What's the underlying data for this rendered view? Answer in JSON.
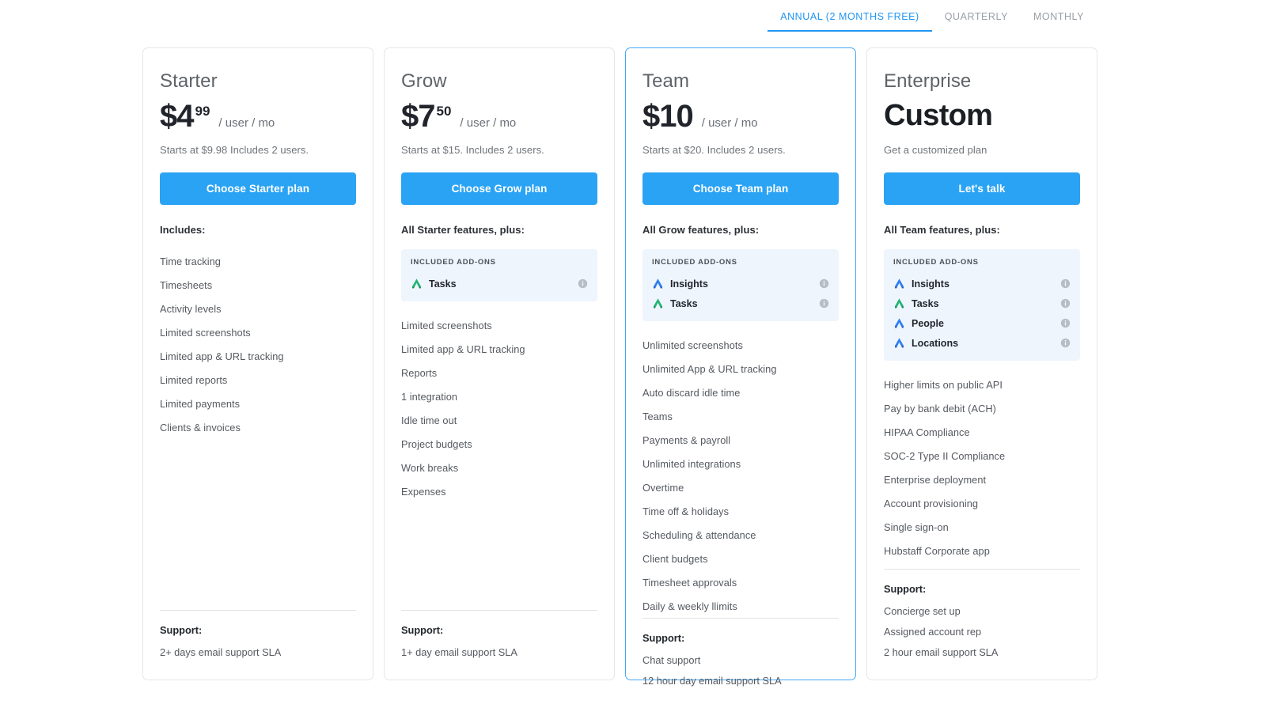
{
  "billing_tabs": [
    {
      "label": "ANNUAL (2 MONTHS FREE)",
      "active": true
    },
    {
      "label": "QUARTERLY",
      "active": false
    },
    {
      "label": "MONTHLY",
      "active": false
    }
  ],
  "colors": {
    "accent": "#2aa3f5",
    "tab_active": "#2196f3",
    "featured_border": "#43a9f5",
    "addon_box_bg": "#eef5fd",
    "icon_green": "#22b573",
    "icon_blue": "#2f7ff0"
  },
  "plans": [
    {
      "name": "Starter",
      "price_amount": "$4",
      "price_cents": "99",
      "price_unit": "/ user / mo",
      "price_note": "Starts at $9.98 Includes 2 users.",
      "cta_label": "Choose Starter plan",
      "includes_label": "Includes:",
      "featured": false,
      "addons": [],
      "features": [
        "Time tracking",
        "Timesheets",
        "Activity levels",
        "Limited screenshots",
        "Limited app & URL tracking",
        "Limited reports",
        "Limited payments",
        "Clients & invoices"
      ],
      "support_title": "Support:",
      "support_items": [
        "2+ days email support SLA"
      ]
    },
    {
      "name": "Grow",
      "price_amount": "$7",
      "price_cents": "50",
      "price_unit": "/ user / mo",
      "price_note": "Starts at $15. Includes 2 users.",
      "cta_label": "Choose Grow plan",
      "includes_label": "All Starter features, plus:",
      "featured": false,
      "addons_title": "INCLUDED ADD-ONS",
      "addons": [
        {
          "label": "Tasks",
          "color": "green"
        }
      ],
      "features": [
        "Limited screenshots",
        "Limited app & URL tracking",
        "Reports",
        "1 integration",
        "Idle time out",
        "Project budgets",
        "Work breaks",
        "Expenses"
      ],
      "support_title": "Support:",
      "support_items": [
        "1+ day email support SLA"
      ]
    },
    {
      "name": "Team",
      "price_amount": "$10",
      "price_cents": "",
      "price_unit": "/ user / mo",
      "price_note": "Starts at $20. Includes 2 users.",
      "cta_label": "Choose Team plan",
      "includes_label": "All Grow features, plus:",
      "featured": true,
      "addons_title": "INCLUDED ADD-ONS",
      "addons": [
        {
          "label": "Insights",
          "color": "blue"
        },
        {
          "label": "Tasks",
          "color": "green"
        }
      ],
      "features": [
        "Unlimited screenshots",
        "Unlimited App & URL tracking",
        "Auto discard idle time",
        "Teams",
        "Payments & payroll",
        "Unlimited integrations",
        "Overtime",
        "Time off & holidays",
        "Scheduling & attendance",
        "Client budgets",
        "Timesheet approvals",
        "Daily & weekly llimits"
      ],
      "support_title": "Support:",
      "support_items": [
        "Chat support",
        "12 hour day email support SLA"
      ]
    },
    {
      "name": "Enterprise",
      "price_custom": "Custom",
      "price_note": "Get a customized plan",
      "cta_label": "Let's talk",
      "includes_label": "All Team features, plus:",
      "featured": false,
      "addons_title": "INCLUDED ADD-ONS",
      "addons": [
        {
          "label": "Insights",
          "color": "blue"
        },
        {
          "label": "Tasks",
          "color": "green"
        },
        {
          "label": "People",
          "color": "blue"
        },
        {
          "label": "Locations",
          "color": "blue"
        }
      ],
      "features": [
        "Higher limits on public API",
        "Pay by bank debit (ACH)",
        "HIPAA Compliance",
        "SOC-2 Type II Compliance",
        "Enterprise deployment",
        "Account provisioning",
        "Single sign-on",
        "Hubstaff Corporate app"
      ],
      "support_title": "Support:",
      "support_items": [
        "Concierge set up",
        "Assigned account rep",
        "2 hour email support SLA"
      ]
    }
  ]
}
